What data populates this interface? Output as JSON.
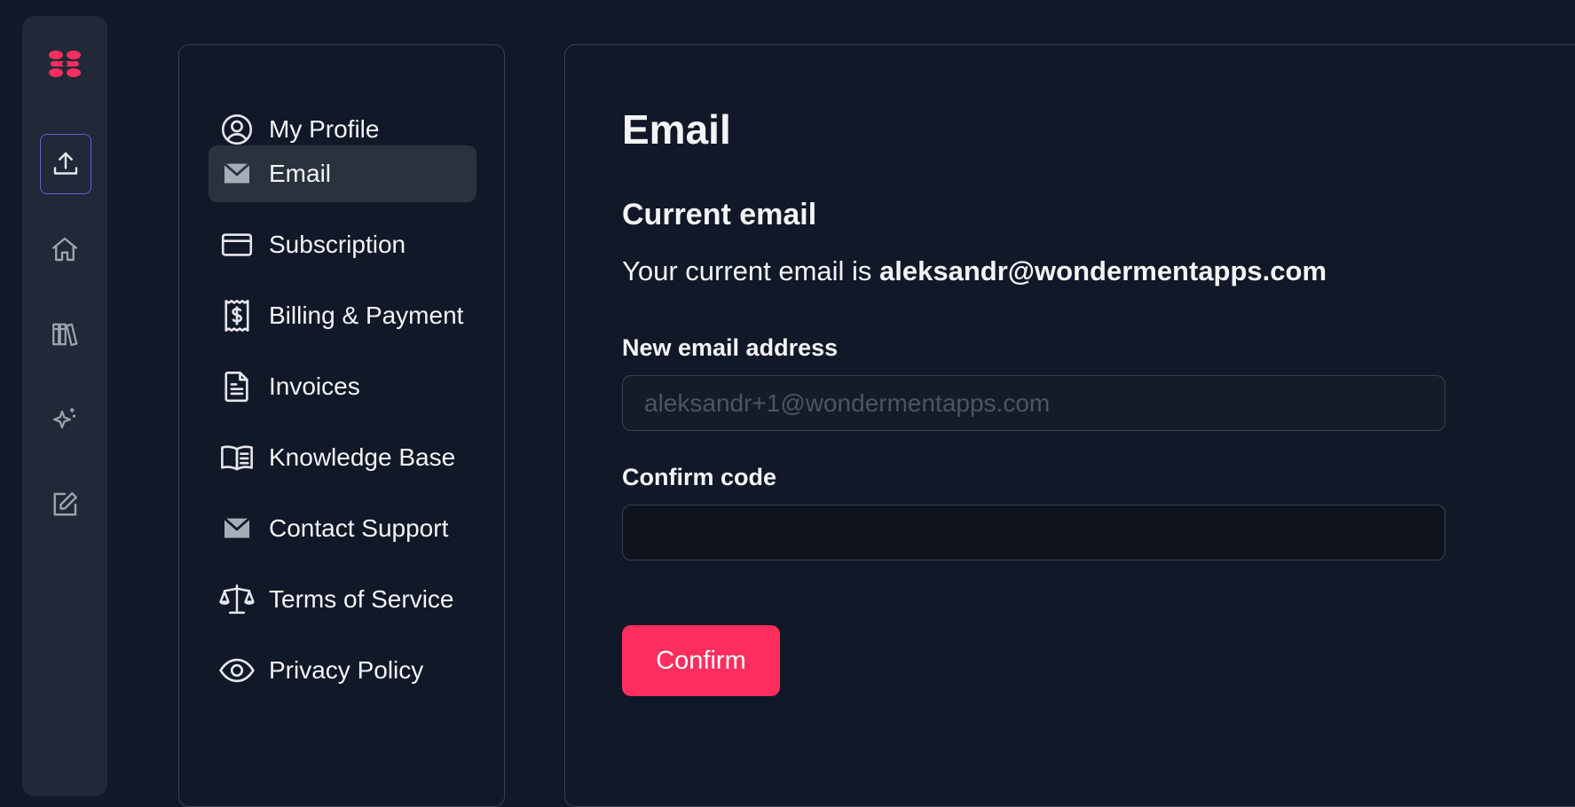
{
  "brand": {
    "accent": "#ff2e5e",
    "logo_icon": "brand-logo-icon"
  },
  "rail": {
    "items": [
      {
        "icon": "upload-icon",
        "active": true
      },
      {
        "icon": "home-icon"
      },
      {
        "icon": "library-icon"
      },
      {
        "icon": "sparkles-icon"
      },
      {
        "icon": "edit-icon"
      }
    ]
  },
  "menu": {
    "items": [
      {
        "label": "My Profile",
        "icon": "user-circle-icon"
      },
      {
        "label": "Email",
        "icon": "envelope-icon",
        "active": true
      },
      {
        "label": "Subscription",
        "icon": "credit-card-icon"
      },
      {
        "label": "Billing & Payment",
        "icon": "receipt-icon"
      },
      {
        "label": "Invoices",
        "icon": "document-icon"
      },
      {
        "label": "Knowledge Base",
        "icon": "book-open-icon"
      },
      {
        "label": "Contact Support",
        "icon": "envelope-icon"
      },
      {
        "label": "Terms of Service",
        "icon": "scale-icon"
      },
      {
        "label": "Privacy Policy",
        "icon": "eye-icon"
      }
    ]
  },
  "main": {
    "title": "Email",
    "section_title": "Current email",
    "current_prefix": "Your current email is ",
    "current_email": "aleksandr@wondermentapps.com",
    "new_email": {
      "label": "New email address",
      "placeholder": "aleksandr+1@wondermentapps.com",
      "value": ""
    },
    "confirm_code": {
      "label": "Confirm code",
      "value": ""
    },
    "confirm_button": "Confirm"
  }
}
